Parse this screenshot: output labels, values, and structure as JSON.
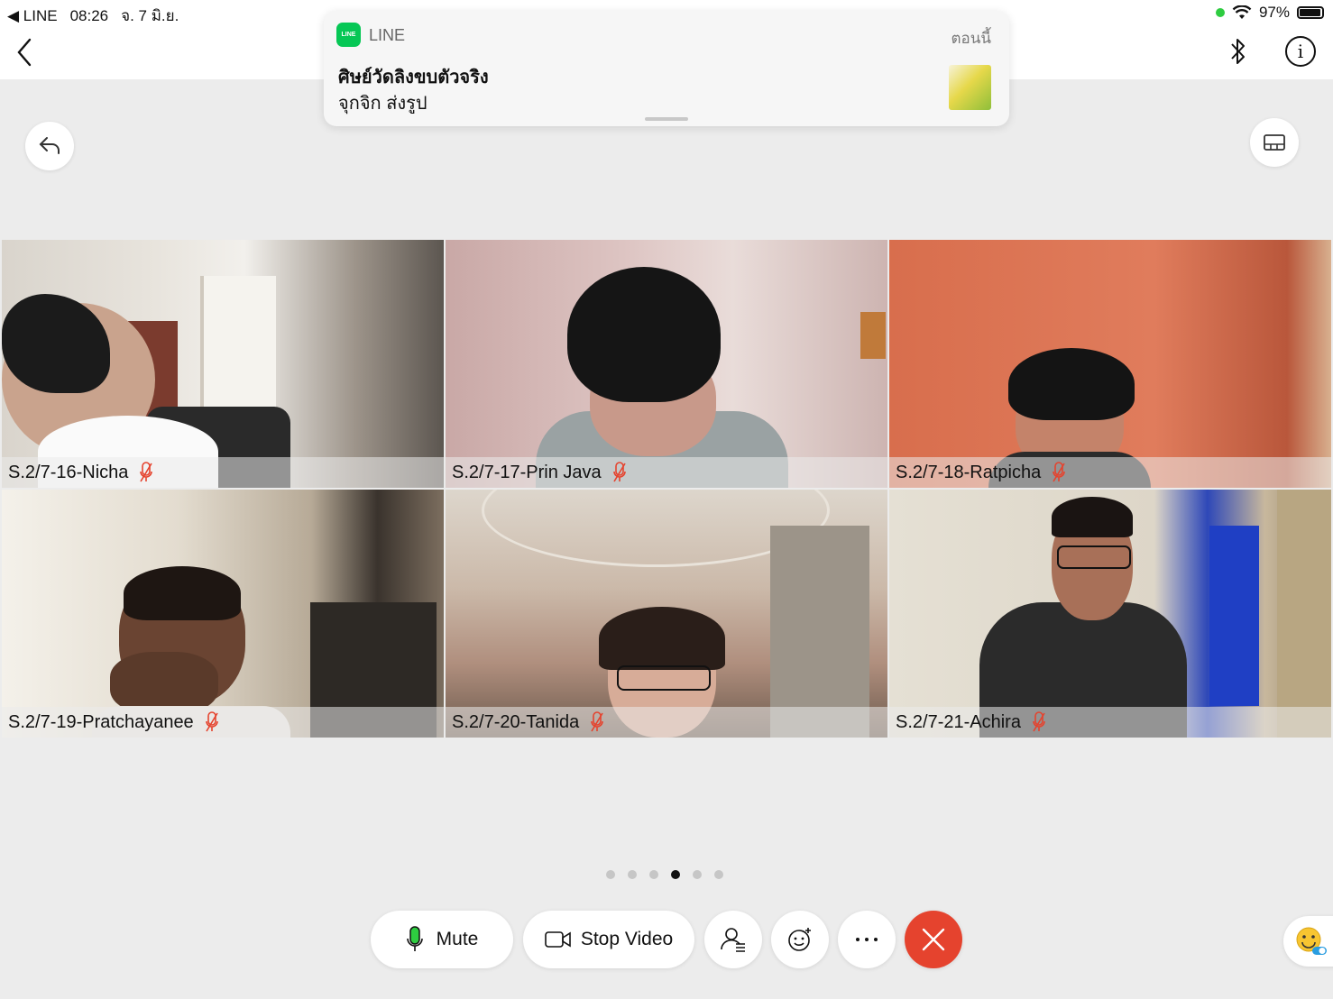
{
  "status_bar": {
    "back_app": "◀ LINE",
    "time": "08:26",
    "date": "จ. 7 มิ.ย.",
    "battery": "97%"
  },
  "notification": {
    "app_icon_text": "LINE",
    "app_name": "LINE",
    "time": "ตอนนี้",
    "title": "ศิษย์วัดลิงขบตัวจริง",
    "body": "จุกจิก ส่งรูป"
  },
  "participants": [
    {
      "name": "S.2/7-16-Nicha",
      "muted": true
    },
    {
      "name": "S.2/7-17-Prin Java",
      "muted": true
    },
    {
      "name": "S.2/7-18-Ratpicha",
      "muted": true
    },
    {
      "name": "S.2/7-19-Pratchayanee",
      "muted": true
    },
    {
      "name": "S.2/7-20-Tanida",
      "muted": true
    },
    {
      "name": "S.2/7-21-Achira",
      "muted": true
    }
  ],
  "pagination": {
    "total": 6,
    "current": 4
  },
  "controls": {
    "mute_label": "Mute",
    "stop_video_label": "Stop Video"
  },
  "colors": {
    "end_call": "#e5432e",
    "line_green": "#06c755",
    "mic_off": "#e5432e"
  }
}
